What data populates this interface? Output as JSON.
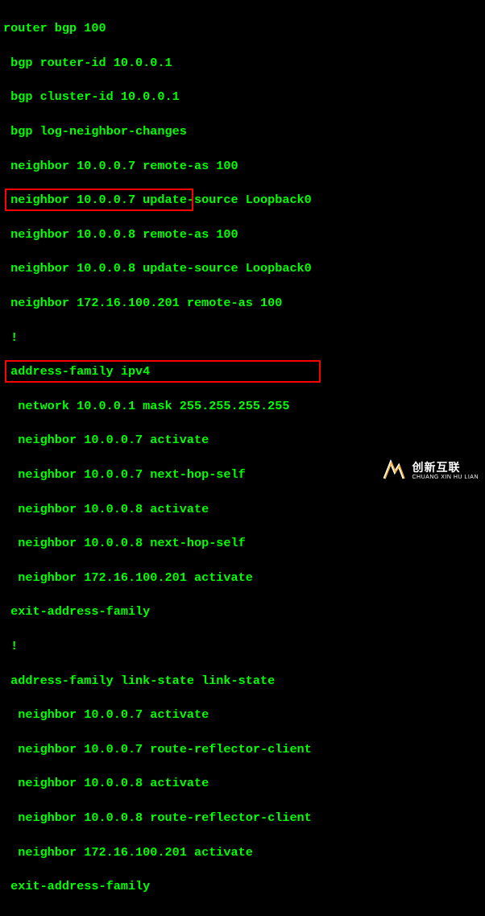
{
  "config": {
    "lines": [
      "router bgp 100",
      " bgp router-id 10.0.0.1",
      " bgp cluster-id 10.0.0.1",
      " bgp log-neighbor-changes",
      " neighbor 10.0.0.7 remote-as 100",
      " neighbor 10.0.0.7 update-source Loopback0",
      " neighbor 10.0.0.8 remote-as 100",
      " neighbor 10.0.0.8 update-source Loopback0",
      " neighbor 172.16.100.201 remote-as 100",
      " !",
      " address-family ipv4",
      "  network 10.0.0.1 mask 255.255.255.255",
      "  neighbor 10.0.0.7 activate",
      "  neighbor 10.0.0.7 next-hop-self",
      "  neighbor 10.0.0.8 activate",
      "  neighbor 10.0.0.8 next-hop-self",
      "  neighbor 172.16.100.201 activate",
      " exit-address-family",
      " !",
      " address-family link-state link-state",
      "  neighbor 10.0.0.7 activate",
      "  neighbor 10.0.0.7 route-reflector-client",
      "  neighbor 10.0.0.8 activate",
      "  neighbor 10.0.0.8 route-reflector-client",
      "  neighbor 172.16.100.201 activate",
      " exit-address-family"
    ]
  },
  "watermark": {
    "cn": "创新互联",
    "en": "CHUANG XIN HU LIAN"
  }
}
